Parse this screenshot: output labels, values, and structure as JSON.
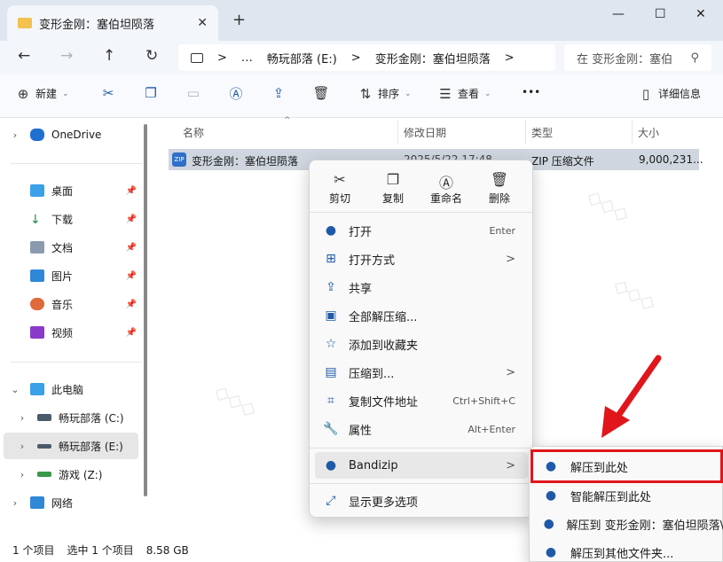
{
  "tab": {
    "title": "变形金刚：塞伯坦陨落",
    "close": "✕",
    "new": "+"
  },
  "window": {
    "min": "—",
    "max": "☐",
    "close": "✕"
  },
  "nav": {
    "back": "←",
    "forward": "→",
    "up": "↑",
    "refresh": "↻"
  },
  "address": {
    "segments": [
      "…",
      "畅玩部落 (E:)",
      "变形金刚：塞伯坦陨落"
    ],
    "sep": ">",
    "search_placeholder": "在 变形金刚：塞伯"
  },
  "toolbar": {
    "new": "新建",
    "sort": "排序",
    "view": "查看",
    "more": "•••",
    "details": "详细信息"
  },
  "sidebar": {
    "items": [
      {
        "label": "OneDrive"
      },
      {
        "label": "桌面"
      },
      {
        "label": "下载"
      },
      {
        "label": "文档"
      },
      {
        "label": "图片"
      },
      {
        "label": "音乐"
      },
      {
        "label": "视频"
      },
      {
        "label": "此电脑"
      },
      {
        "label": "畅玩部落 (C:)"
      },
      {
        "label": "畅玩部落 (E:)"
      },
      {
        "label": "游戏 (Z:)"
      },
      {
        "label": "网络"
      }
    ]
  },
  "columns": {
    "name": "名称",
    "date": "修改日期",
    "type": "类型",
    "size": "大小"
  },
  "file": {
    "name": "变形金刚：塞伯坦陨落",
    "date": "2025/5/22 17:48",
    "type": "ZIP 压缩文件",
    "size": "9,000,231..."
  },
  "status": {
    "count": "1 个项目",
    "selected": "选中 1 个项目",
    "size": "8.58 GB"
  },
  "context": {
    "quick": [
      {
        "label": "剪切"
      },
      {
        "label": "复制"
      },
      {
        "label": "重命名"
      },
      {
        "label": "删除"
      }
    ],
    "items": [
      {
        "label": "打开",
        "shortcut": "Enter"
      },
      {
        "label": "打开方式",
        "arrow": ">"
      },
      {
        "label": "共享"
      },
      {
        "label": "全部解压缩..."
      },
      {
        "label": "添加到收藏夹"
      },
      {
        "label": "压缩到...",
        "arrow": ">"
      },
      {
        "label": "复制文件地址",
        "shortcut": "Ctrl+Shift+C"
      },
      {
        "label": "属性",
        "shortcut": "Alt+Enter"
      },
      {
        "label": "Bandizip",
        "arrow": ">"
      },
      {
        "label": "显示更多选项"
      }
    ]
  },
  "submenu": {
    "items": [
      {
        "label": "解压到此处"
      },
      {
        "label": "智能解压到此处"
      },
      {
        "label": "解压到 变形金刚：塞伯坦陨落\\"
      },
      {
        "label": "解压到其他文件夹..."
      }
    ]
  },
  "colors": {
    "accent": "#1e5aa8",
    "highlight_box": "#e0161b",
    "arrow": "#e0161b"
  }
}
